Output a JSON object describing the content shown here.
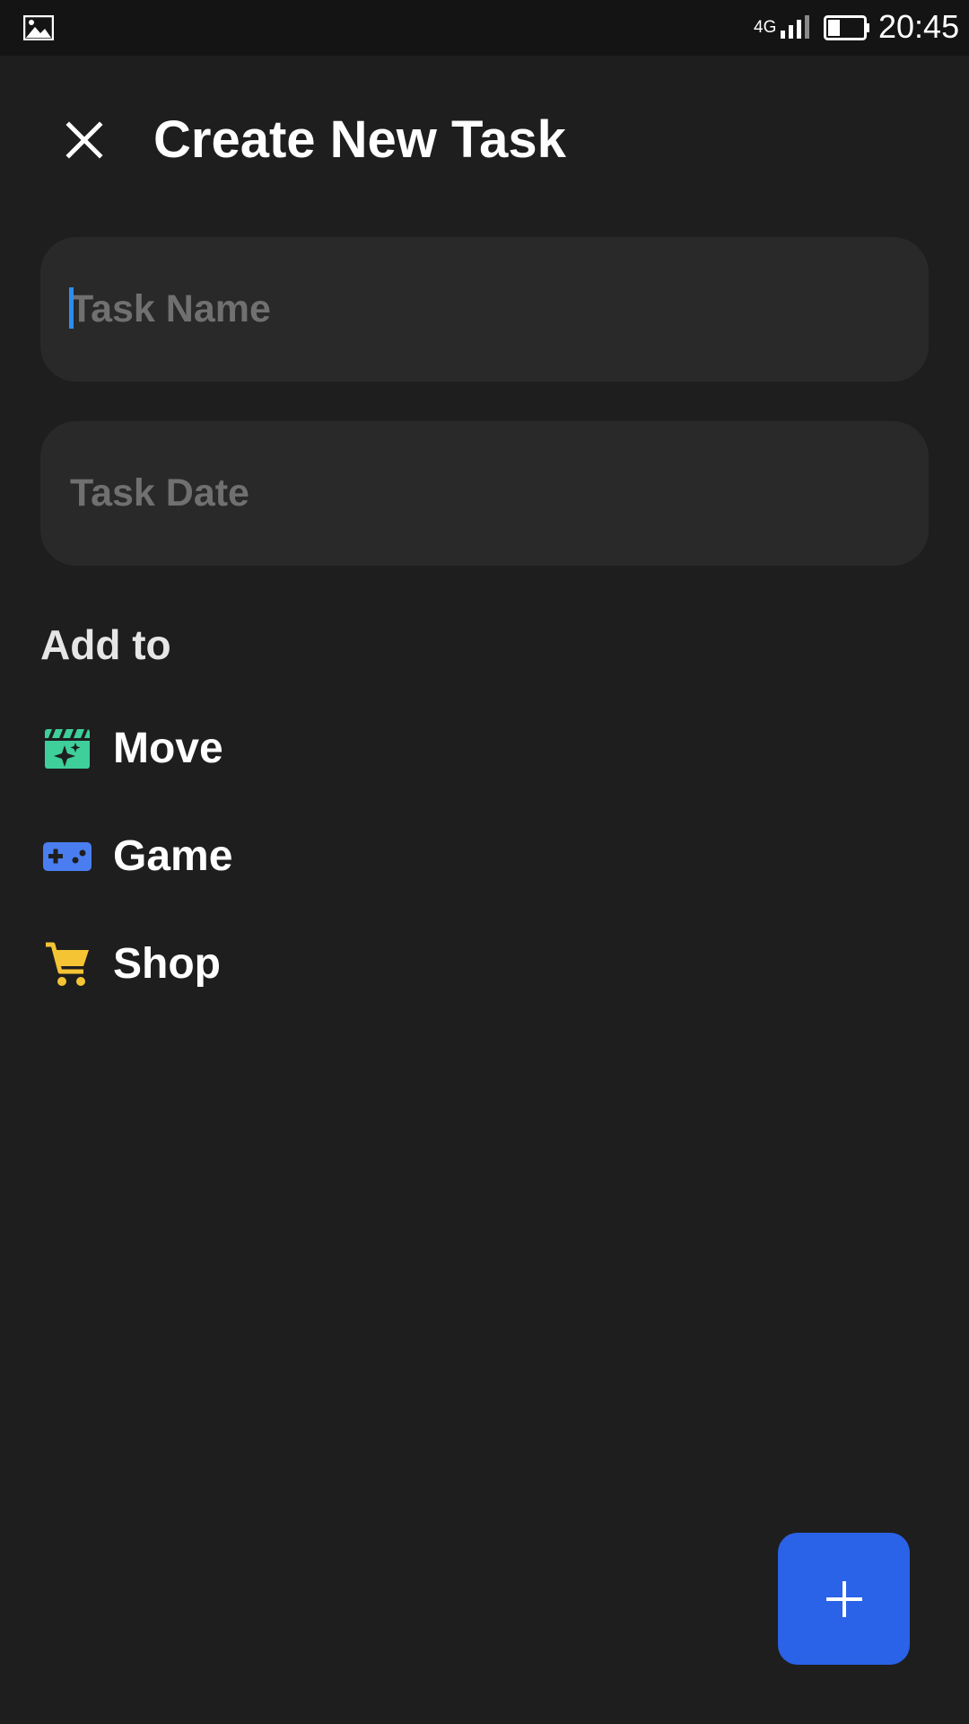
{
  "status_bar": {
    "gallery_icon": "image-icon",
    "network": "4G",
    "signal_icon": "signal-icon",
    "battery_icon": "battery-icon",
    "time": "20:45"
  },
  "header": {
    "close_icon": "close-icon",
    "title": "Create New Task"
  },
  "form": {
    "task_name": {
      "value": "",
      "placeholder": "Task Name"
    },
    "task_date": {
      "value": "",
      "placeholder": "Task Date"
    }
  },
  "add_to": {
    "label": "Add to",
    "items": [
      {
        "label": "Move",
        "icon": "movie-icon",
        "color": "#3ecf9b"
      },
      {
        "label": "Game",
        "icon": "gamepad-icon",
        "color": "#4a7ef0"
      },
      {
        "label": "Shop",
        "icon": "cart-icon",
        "color": "#f5c434"
      }
    ]
  },
  "fab": {
    "icon": "plus-icon",
    "color": "#2a62e8"
  },
  "colors": {
    "background": "#1e1e1e",
    "field_background": "#292929",
    "accent": "#2a8ef0"
  }
}
